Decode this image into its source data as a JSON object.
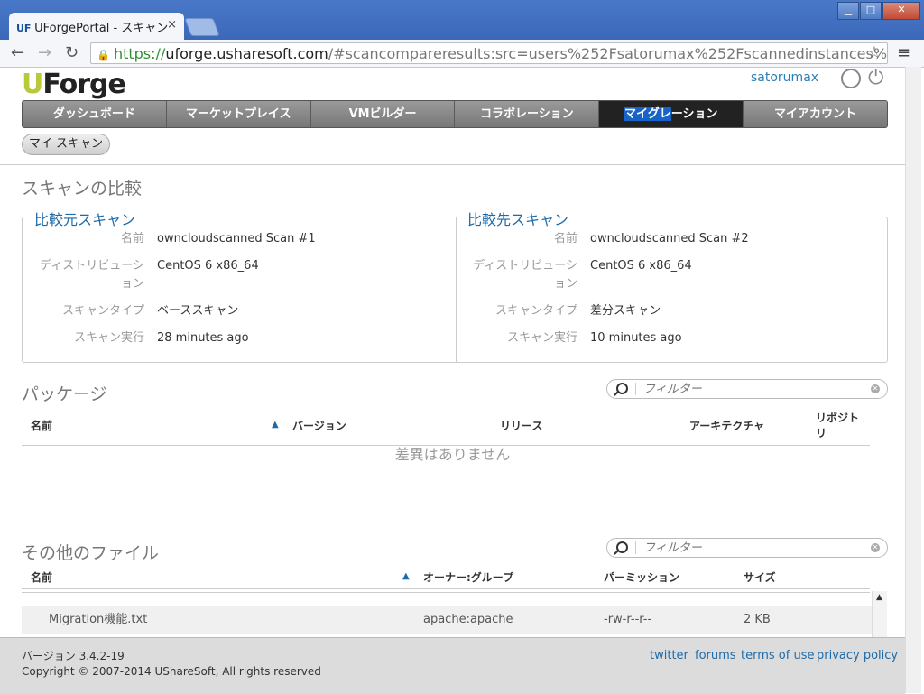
{
  "browser": {
    "tab_title": "UForgePortal - スキャン",
    "tab_close": "×",
    "favicon": "UF",
    "url_scheme": "https://",
    "url_host": "uforge.usharesoft.com",
    "url_rest": "/#scancompareresults:src=users%252Fsatorumax%252Fscannedinstances%"
  },
  "header": {
    "logo_u": "U",
    "logo_rest": "Forge",
    "username": "satorumax"
  },
  "nav": {
    "items": [
      "ダッシュボード",
      "マーケットプレイス",
      "VMビルダー",
      "コラボレーション",
      "マイアカウント"
    ],
    "active_highlight": "マイグレ",
    "active_rest": "ーション"
  },
  "subnav": {
    "my_scan": "マイ スキャン"
  },
  "compare": {
    "title": "スキャンの比較",
    "source_title": "比較元スキャン",
    "target_title": "比較先スキャン",
    "labels": {
      "name": "名前",
      "distribution_1": "ディストリビューシ",
      "distribution_2": "ョン",
      "scan_type": "スキャンタイプ",
      "scan_run": "スキャン実行"
    },
    "source": {
      "name": "owncloudscanned Scan #1",
      "distribution": "CentOS 6 x86_64",
      "scan_type": "ベーススキャン",
      "scan_run": "28 minutes ago"
    },
    "target": {
      "name": "owncloudscanned Scan #2",
      "distribution": "CentOS 6 x86_64",
      "scan_type": "差分スキャン",
      "scan_run": "10 minutes ago"
    }
  },
  "packages": {
    "title": "パッケージ",
    "filter_placeholder": "フィルター",
    "columns": {
      "name": "名前",
      "version": "バージョン",
      "release": "リリース",
      "arch": "アーキテクチャ",
      "repo_1": "リポジト",
      "repo_2": "リ"
    },
    "empty": "差異はありません"
  },
  "files": {
    "title": "その他のファイル",
    "filter_placeholder": "フィルター",
    "columns": {
      "name": "名前",
      "owner": "オーナー:グループ",
      "perm": "パーミッション",
      "size": "サイズ"
    },
    "row": {
      "name": "Migration機能.txt",
      "owner": "apache:apache",
      "perm": "-rw-r--r--",
      "size": "2 KB"
    }
  },
  "footer": {
    "version": "バージョン 3.4.2-19",
    "copyright": "Copyright © 2007-2014 UShareSoft, All rights reserved",
    "links": [
      "twitter",
      "forums",
      "terms of use",
      "privacy policy"
    ]
  }
}
